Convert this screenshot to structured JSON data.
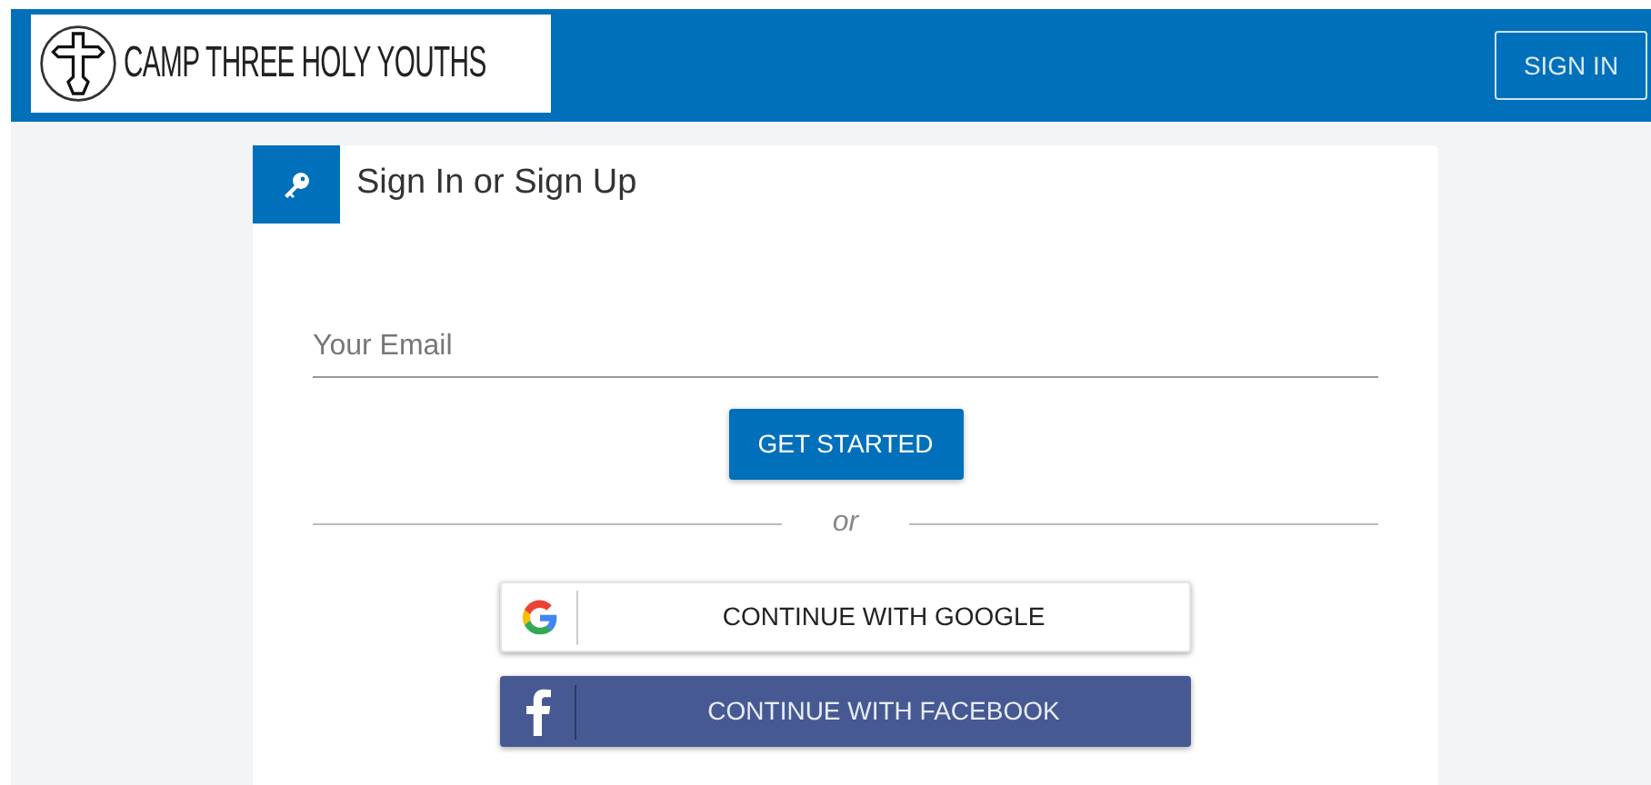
{
  "header": {
    "logo_text": "CAMP THREE HOLY YOUTHS",
    "sign_in": "SIGN IN"
  },
  "card": {
    "title": "Sign In or Sign Up",
    "email": {
      "placeholder": "Your Email"
    },
    "submit": "GET STARTED",
    "divider": "or",
    "social": [
      {
        "kind": "google",
        "label": "CONTINUE WITH GOOGLE"
      },
      {
        "kind": "facebook",
        "label": "CONTINUE WITH FACEBOOK"
      }
    ]
  }
}
